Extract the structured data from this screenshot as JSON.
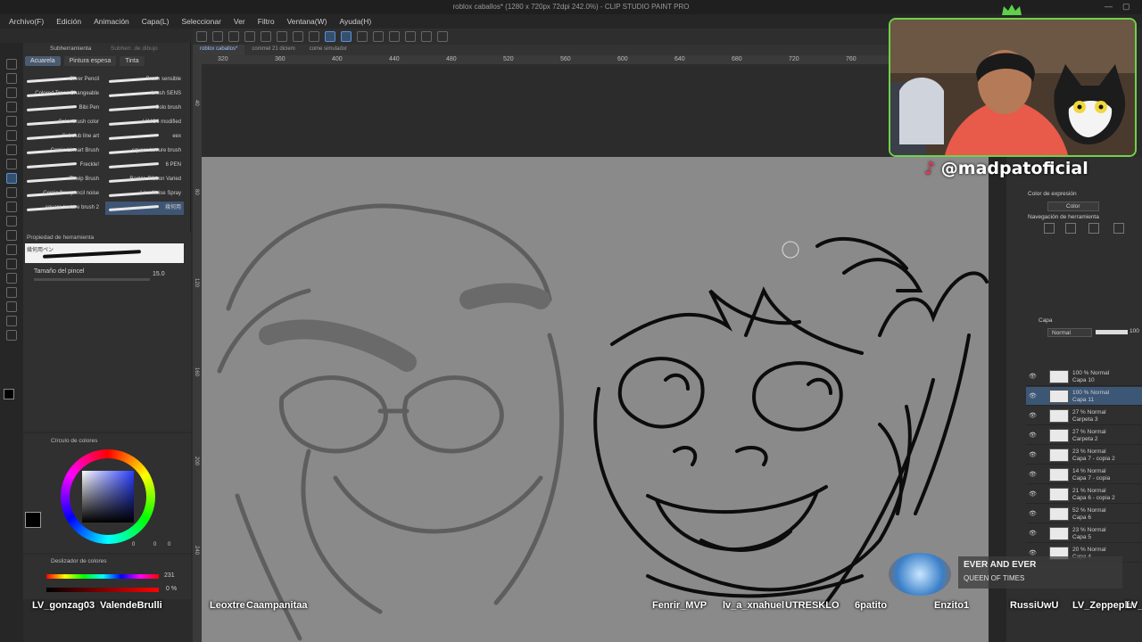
{
  "window": {
    "title": "roblox caballos* (1280 x 720px 72dpi 242.0%) - CLIP STUDIO PAINT PRO"
  },
  "menu": [
    "Archivo(F)",
    "Edición",
    "Animación",
    "Capa(L)",
    "Seleccionar",
    "Ver",
    "Filtro",
    "Ventana(W)",
    "Ayuda(H)"
  ],
  "doc_tabs": [
    "roblox caballos*",
    "commel 21 diciem",
    "come simulador"
  ],
  "ruler_ticks": [
    "320",
    "360",
    "400",
    "440",
    "480",
    "520",
    "560",
    "600",
    "640",
    "680",
    "720",
    "760"
  ],
  "ruler_v_ticks": [
    "40",
    "80",
    "120",
    "160",
    "200",
    "240"
  ],
  "subtool": {
    "header": "Subherramienta",
    "header2": "Subherr. de dibujo",
    "tabs": [
      "Acuarela",
      "Pintura espesa",
      "Tinta"
    ],
    "brushes_left": [
      "Sliver Pencil",
      "Colored Trees Changeable",
      "Bibi Pen",
      "Color brush color",
      "Subclub line art",
      "Comic Lineart Brush",
      "Freckle!",
      "Thwip Brush",
      "Comic flow pencil noise",
      "square texture brush 2"
    ],
    "brushes_right": [
      "Brush sensible",
      "brush SENS",
      "Colo brush",
      "HIMG6 modified",
      "eex",
      "square texture brush",
      "6 PEN",
      "Rackle Ribbon Varied",
      "Line Noise Spray",
      "幾何用"
    ]
  },
  "tool_property": {
    "header": "Propiedad de herramienta",
    "brush_name": "幾何用ペン",
    "size_label": "Tamaño del pincel",
    "size_value": "15.0"
  },
  "color_wheel": {
    "header": "Círculo de colores",
    "values": [
      "0",
      "0",
      "0"
    ]
  },
  "color_slider": {
    "header": "Deslizador de colores",
    "values": [
      "231",
      "0 %",
      "0 %"
    ]
  },
  "right_panel": {
    "expression_color_label": "Color de expresión",
    "expression_color_value": "Color",
    "nav_label": "Navegación de herramienta",
    "layer_panel_label": "Capa",
    "blend_mode": "Normal",
    "opacity": "100"
  },
  "layers": [
    {
      "opacity": "100 % Normal",
      "name": "Capa 10",
      "selected": false
    },
    {
      "opacity": "100 % Normal",
      "name": "Capa 11",
      "selected": true
    },
    {
      "opacity": "27 % Normal",
      "name": "Carpeta 3",
      "selected": false
    },
    {
      "opacity": "27 % Normal",
      "name": "Carpeta 2",
      "selected": false
    },
    {
      "opacity": "23 % Normal",
      "name": "Capa 7 - copia 2",
      "selected": false
    },
    {
      "opacity": "14 % Normal",
      "name": "Capa 7 - copia",
      "selected": false
    },
    {
      "opacity": "21 % Normal",
      "name": "Capa 6 - copia 2",
      "selected": false
    },
    {
      "opacity": "52 % Normal",
      "name": "Capa 6",
      "selected": false
    },
    {
      "opacity": "23 % Normal",
      "name": "Capa 5",
      "selected": false
    },
    {
      "opacity": "20 % Normal",
      "name": "Capa 4",
      "selected": false
    }
  ],
  "social_handle": "@madpatoficial",
  "now_playing": {
    "title": "EVER AND EVER",
    "subtitle": "QUEEN OF TIMES"
  },
  "chat_names": [
    "LV_gonzag03",
    "ValendeBrulli",
    "Leoxtre",
    "Caampanitaa",
    "Fenrir_MVP",
    "lv_a_xnahuel",
    "UTRESKLO",
    "6patito",
    "Enzito1",
    "RussiUwU",
    "LV_Zeppeplin",
    "LV_La"
  ],
  "colors": {
    "accent": "#5c8fd0",
    "webcam_border": "#6fd24a",
    "canvas_bg": "#8a8a8a"
  }
}
